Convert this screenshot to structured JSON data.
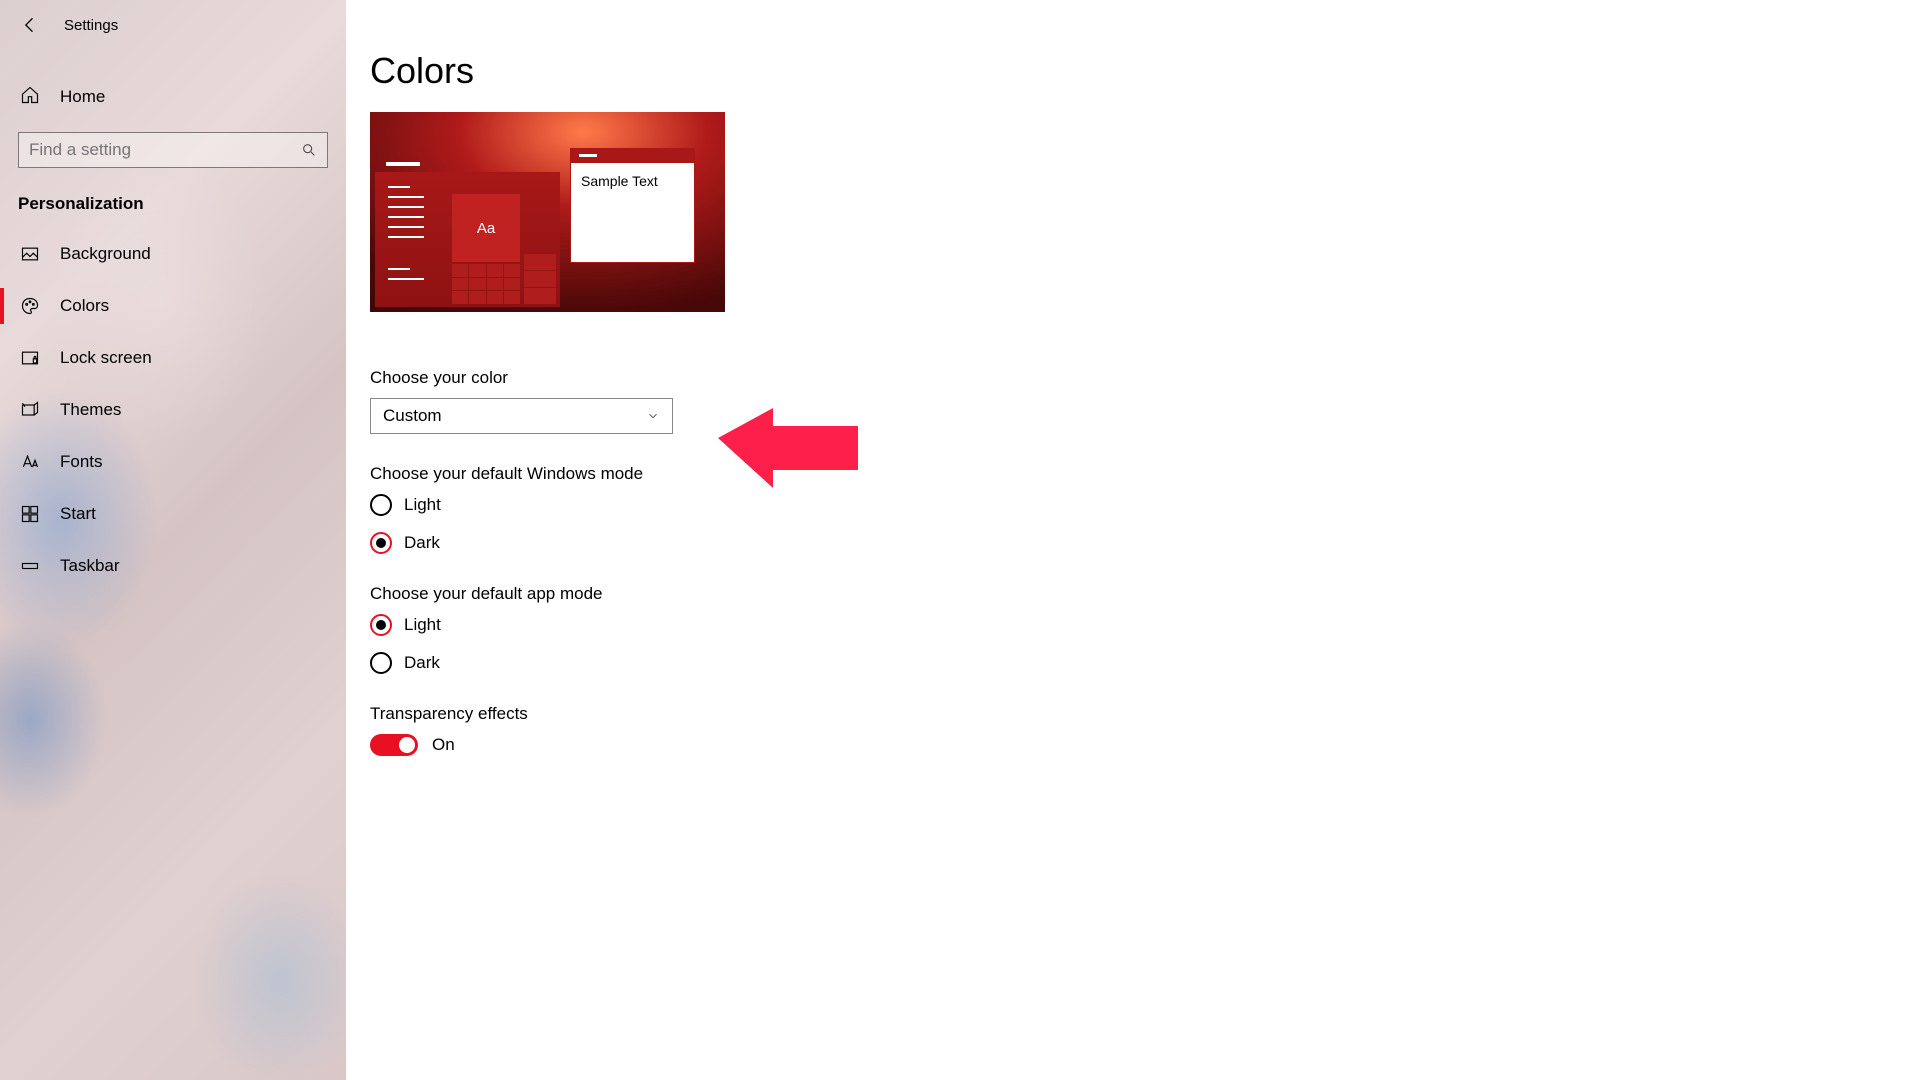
{
  "app_title": "Settings",
  "home_label": "Home",
  "search_placeholder": "Find a setting",
  "section": "Personalization",
  "nav": [
    {
      "label": "Background",
      "icon": "image-icon"
    },
    {
      "label": "Colors",
      "icon": "palette-icon",
      "active": true
    },
    {
      "label": "Lock screen",
      "icon": "lockscreen-icon"
    },
    {
      "label": "Themes",
      "icon": "themes-icon"
    },
    {
      "label": "Fonts",
      "icon": "fonts-icon"
    },
    {
      "label": "Start",
      "icon": "start-icon"
    },
    {
      "label": "Taskbar",
      "icon": "taskbar-icon"
    }
  ],
  "page_title": "Colors",
  "preview": {
    "tile_text": "Aa",
    "window_text": "Sample Text"
  },
  "choose_color": {
    "label": "Choose your color",
    "value": "Custom"
  },
  "windows_mode": {
    "label": "Choose your default Windows mode",
    "options": [
      "Light",
      "Dark"
    ],
    "selected": "Dark"
  },
  "app_mode": {
    "label": "Choose your default app mode",
    "options": [
      "Light",
      "Dark"
    ],
    "selected": "Light"
  },
  "transparency": {
    "label": "Transparency effects",
    "state_label": "On"
  },
  "colors": {
    "accent": "#e81123"
  }
}
